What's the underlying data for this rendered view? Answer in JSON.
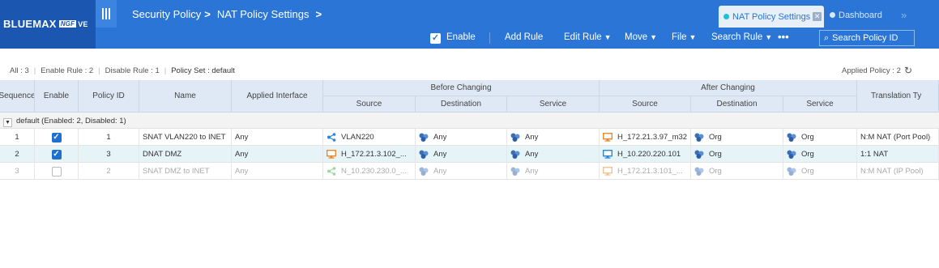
{
  "brand": {
    "name": "BLUEMAX",
    "edition": "NGF",
    "suffix": "VE"
  },
  "breadcrumb": [
    "Security Policy",
    "NAT Policy Settings"
  ],
  "tabs": [
    {
      "label": "NAT Policy Settings",
      "active": true
    },
    {
      "label": "Dashboard",
      "active": false
    }
  ],
  "toolbar": {
    "enable_label": "Enable",
    "enable_checked": true,
    "add_rule": "Add Rule",
    "edit_rule": "Edit Rule",
    "move": "Move",
    "file": "File",
    "search_rule": "Search Rule",
    "more": "•••",
    "search_policy_placeholder": "Search Policy ID"
  },
  "summary": {
    "all": "All : 3",
    "enable_rule": "Enable Rule : 2",
    "disable_rule": "Disable Rule : 1",
    "policy_set": "Policy Set : default",
    "applied_policy": "Applied Policy : 2"
  },
  "table": {
    "headers": {
      "sequence": "Sequence",
      "enable": "Enable",
      "policy_id": "Policy ID",
      "name": "Name",
      "applied_interface": "Applied Interface",
      "before_changing": "Before Changing",
      "after_changing": "After Changing",
      "translation_type": "Translation Ty",
      "source": "Source",
      "destination": "Destination",
      "service": "Service"
    },
    "group_label": "default (Enabled: 2, Disabled: 1)",
    "rows": [
      {
        "sequence": "1",
        "enabled": true,
        "policy_id": "1",
        "name": "SNAT VLAN220 to INET",
        "interface": "Any",
        "before_source": "VLAN220",
        "before_source_icon": "network-share-icon",
        "before_destination": "Any",
        "before_service": "Any",
        "after_source": "H_172.21.3.97_m32",
        "after_source_icon": "host-orange-icon",
        "after_destination": "Org",
        "after_service": "Org",
        "translation": "N:M NAT (Port Pool)",
        "state": "normal"
      },
      {
        "sequence": "2",
        "enabled": true,
        "policy_id": "3",
        "name": "DNAT DMZ",
        "interface": "Any",
        "before_source": "H_172.21.3.102_...",
        "before_source_icon": "host-orange-icon",
        "before_destination": "Any",
        "before_service": "Any",
        "after_source": "H_10.220.220.101",
        "after_source_icon": "host-blue-icon",
        "after_destination": "Org",
        "after_service": "Org",
        "translation": "1:1 NAT",
        "state": "selected"
      },
      {
        "sequence": "3",
        "enabled": false,
        "policy_id": "2",
        "name": "SNAT DMZ to INET",
        "interface": "Any",
        "before_source": "N_10.230.230.0_...",
        "before_source_icon": "network-share-green-icon",
        "before_destination": "Any",
        "before_service": "Any",
        "after_source": "H_172.21.3.101_...",
        "after_source_icon": "host-orange-icon",
        "after_destination": "Org",
        "after_service": "Org",
        "translation": "N:M NAT (IP Pool)",
        "state": "disabled"
      }
    ]
  },
  "colors": {
    "header_bg": "#2a75d5",
    "logo_bg": "#1b56b0",
    "table_header_bg": "#dfe9f5",
    "selected_row_bg": "#e6f4f7",
    "host_orange": "#e8892c",
    "host_blue": "#2c86d6",
    "object_blue": "#3a6fb8"
  }
}
